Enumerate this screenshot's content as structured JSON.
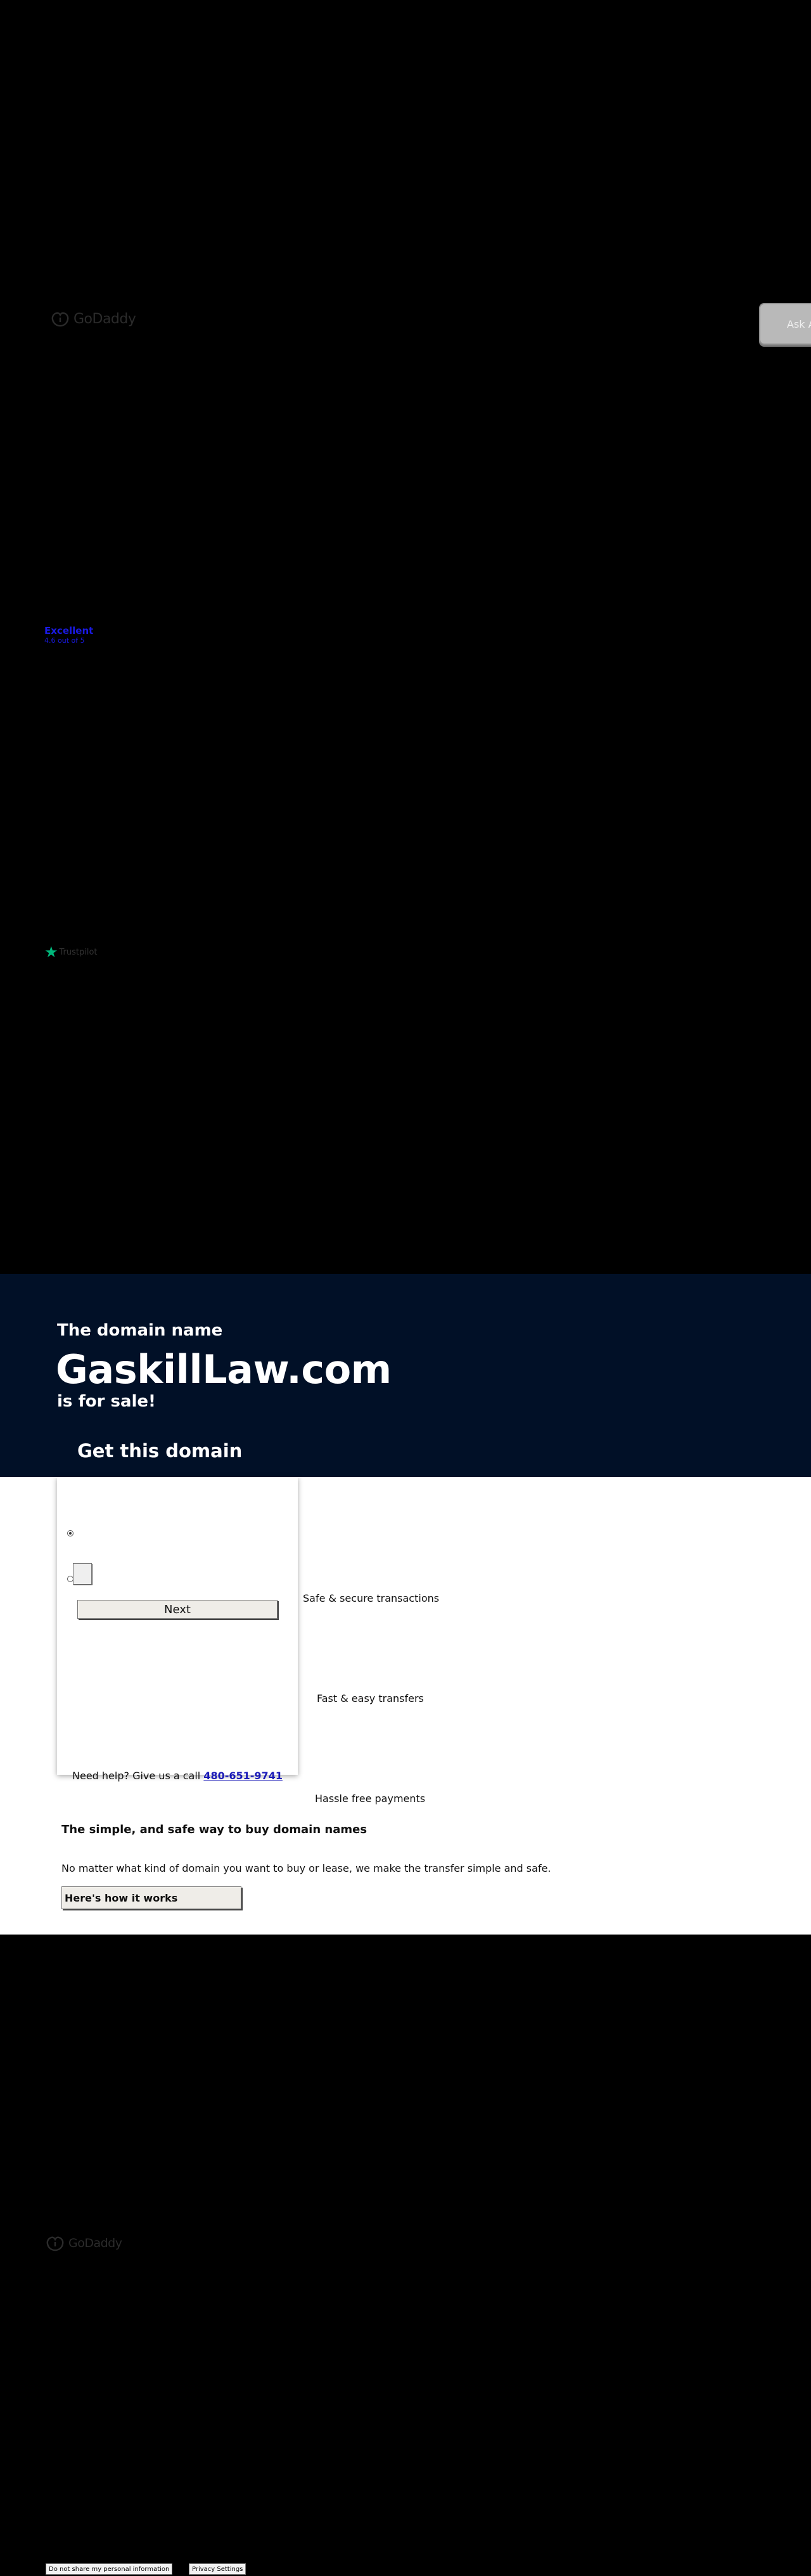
{
  "header": {
    "logo_text": "GoDaddy"
  },
  "chat": {
    "ask_label": "Ask A"
  },
  "rating": {
    "title": "Excellent",
    "subtitle": "4.6 out of 5"
  },
  "trustpilot": {
    "brand": "Trustpilot"
  },
  "hero": {
    "pre": "The domain name",
    "domain": "GaskillLaw.com",
    "post": "is for sale!",
    "cta_heading": "Get this domain"
  },
  "form": {
    "next_label": "Next"
  },
  "features": [
    {
      "label": "Safe & secure transactions"
    },
    {
      "label": "Fast & easy transfers"
    },
    {
      "label": "Hassle free payments"
    }
  ],
  "help": {
    "text": "Need help? Give us a call ",
    "phone": "480-651-9741"
  },
  "info": {
    "title": "The simple, and safe way to buy domain names",
    "description": "No matter what kind of domain you want to buy or lease, we make the transfer simple and safe.",
    "button_label": "Here's how it works"
  },
  "footer": {
    "logo_text": "GoDaddy",
    "do_not_share": "Do not share my personal information",
    "privacy_settings": "Privacy Settings"
  }
}
